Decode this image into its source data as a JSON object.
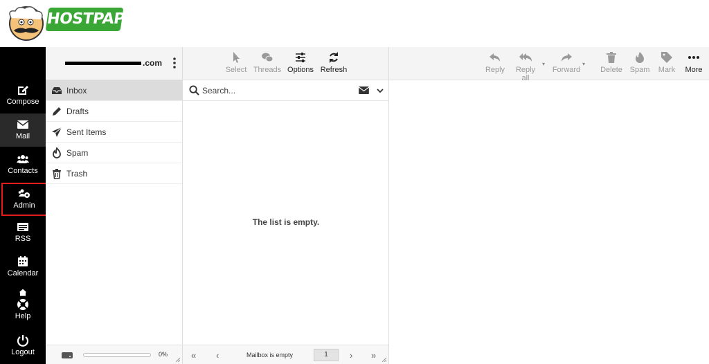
{
  "brand": {
    "logo_text": "HOSTPAPA"
  },
  "nav": {
    "items": [
      {
        "label": "Compose",
        "icon": "compose-icon"
      },
      {
        "label": "Mail",
        "icon": "mail-icon"
      },
      {
        "label": "Contacts",
        "icon": "contacts-icon"
      },
      {
        "label": "Admin",
        "icon": "admin-icon"
      },
      {
        "label": "RSS",
        "icon": "rss-icon"
      },
      {
        "label": "Calendar",
        "icon": "calendar-icon"
      },
      {
        "label": "Help",
        "icon": "help-icon"
      },
      {
        "label": "Logout",
        "icon": "power-icon"
      }
    ],
    "active": "Mail",
    "highlighted": "Admin"
  },
  "account": {
    "email_suffix": ".com"
  },
  "folders": {
    "items": [
      {
        "label": "Inbox",
        "icon": "inbox-icon"
      },
      {
        "label": "Drafts",
        "icon": "pencil-icon"
      },
      {
        "label": "Sent Items",
        "icon": "paper-plane-icon"
      },
      {
        "label": "Spam",
        "icon": "flame-icon"
      },
      {
        "label": "Trash",
        "icon": "trash-icon"
      }
    ],
    "active": "Inbox",
    "quota_text": "0%",
    "quota_percent": 0
  },
  "list_toolbar": {
    "select": "Select",
    "threads": "Threads",
    "options": "Options",
    "refresh": "Refresh"
  },
  "search": {
    "placeholder": "Search..."
  },
  "list": {
    "empty_message": "The list is empty.",
    "status": "Mailbox is empty",
    "page": "1"
  },
  "view_toolbar": {
    "reply": "Reply",
    "reply_all": "Reply all",
    "forward": "Forward",
    "delete": "Delete",
    "spam": "Spam",
    "mark": "Mark",
    "more": "More"
  },
  "colors": {
    "nav_bg": "#000000",
    "highlight": "#e21b1b",
    "brand_green": "#3aa636"
  }
}
